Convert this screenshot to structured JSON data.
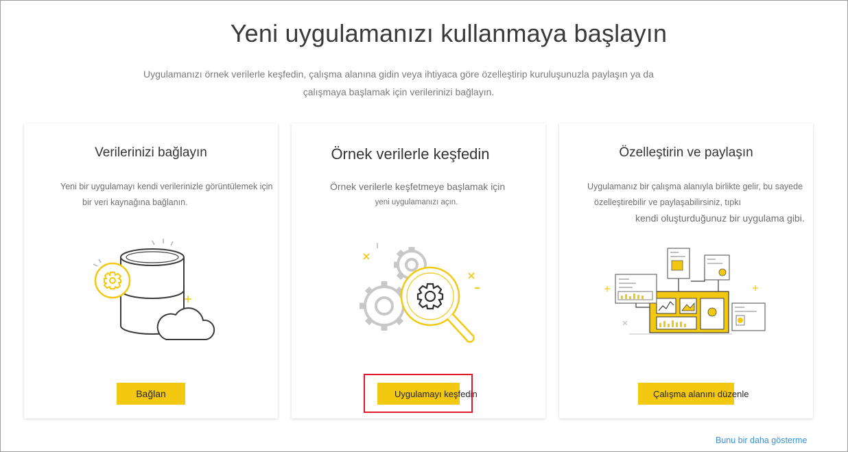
{
  "header": {
    "title": "Yeni uygulamanızı kullanmaya başlayın",
    "subtitle_line1": "Uygulamanızı örnek verilerle keşfedin, çalışma alanına gidin veya ihtiyaca göre özelleştirip kuruluşunuzla paylaşın ya da",
    "subtitle_line2": "çalışmaya başlamak için verilerinizi bağlayın."
  },
  "cards": [
    {
      "title": "Verilerinizi bağlayın",
      "desc_line1": "Yeni bir uygulamayı kendi verilerinizle görüntülemek için",
      "desc_line2": "bir veri kaynağına bağlanın.",
      "button_label": "Bağlan",
      "illustration": "database-cloud-gear-icon"
    },
    {
      "title": "Örnek verilerle keşfedin",
      "desc_line1": "Örnek verilerle keşfetmeye başlamak için",
      "desc_line2": "yeni uygulamanızı açın.",
      "button_label": "Uygulamayı keşfedin",
      "illustration": "gears-magnifier-icon"
    },
    {
      "title": "Özelleştirin ve paylaşın",
      "desc_line1": "Uygulamanız bir çalışma alanıyla birlikte gelir, bu sayede",
      "desc_line2": "özelleştirebilir ve paylaşabilirsiniz, tıpkı",
      "desc_line3": "kendi oluşturduğunuz bir uygulama gibi.",
      "button_label": "Çalışma alanını düzenle",
      "illustration": "dashboard-network-icon"
    }
  ],
  "footer": {
    "dismiss_label": "Bunu bir daha gösterme"
  },
  "colors": {
    "accent": "#f2c811",
    "highlight": "#e3182d",
    "link": "#3a8fd6"
  }
}
